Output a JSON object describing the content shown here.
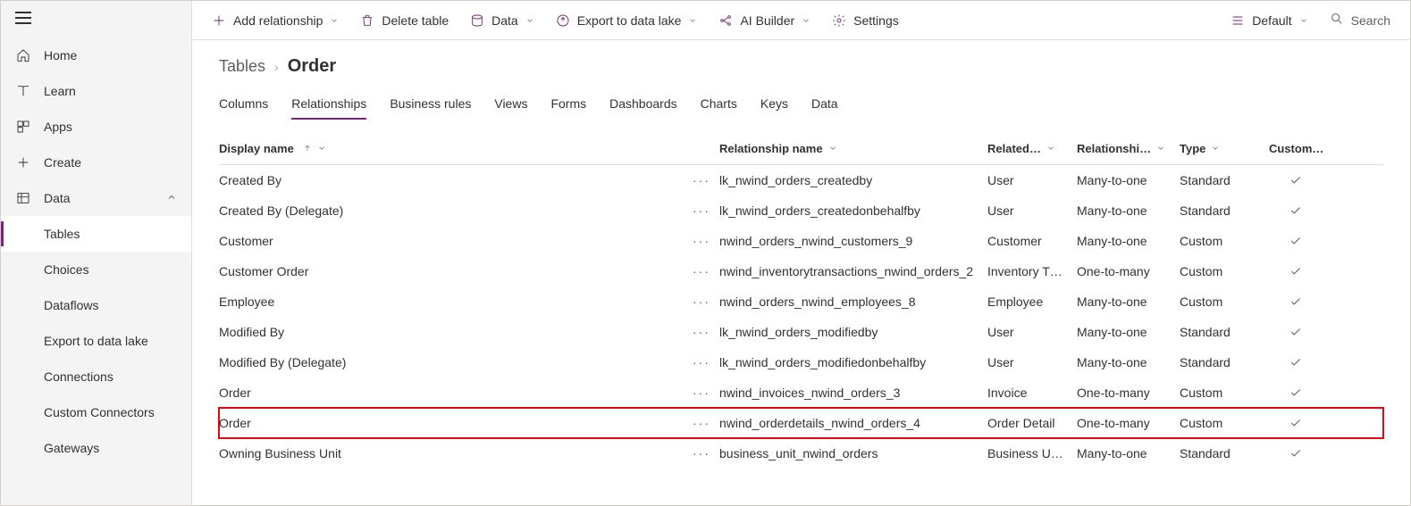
{
  "sidebar": {
    "items": [
      {
        "label": "Home"
      },
      {
        "label": "Learn"
      },
      {
        "label": "Apps"
      },
      {
        "label": "Create"
      },
      {
        "label": "Data"
      }
    ],
    "dataChildren": [
      {
        "label": "Tables"
      },
      {
        "label": "Choices"
      },
      {
        "label": "Dataflows"
      },
      {
        "label": "Export to data lake"
      },
      {
        "label": "Connections"
      },
      {
        "label": "Custom Connectors"
      },
      {
        "label": "Gateways"
      }
    ]
  },
  "commandBar": {
    "addRelationship": "Add relationship",
    "deleteTable": "Delete table",
    "data": "Data",
    "exportDataLake": "Export to data lake",
    "aiBuilder": "AI Builder",
    "settings": "Settings",
    "default": "Default",
    "search": "Search"
  },
  "breadcrumb": {
    "parent": "Tables",
    "current": "Order"
  },
  "tabs": [
    "Columns",
    "Relationships",
    "Business rules",
    "Views",
    "Forms",
    "Dashboards",
    "Charts",
    "Keys",
    "Data"
  ],
  "activeTab": "Relationships",
  "columns": {
    "displayName": "Display name",
    "relName": "Relationship name",
    "related": "Related…",
    "relType": "Relationshi…",
    "type": "Type",
    "custom": "Custom…"
  },
  "rows": [
    {
      "display": "Created By",
      "name": "lk_nwind_orders_createdby",
      "related": "User",
      "reltype": "Many-to-one",
      "type": "Standard"
    },
    {
      "display": "Created By (Delegate)",
      "name": "lk_nwind_orders_createdonbehalfby",
      "related": "User",
      "reltype": "Many-to-one",
      "type": "Standard"
    },
    {
      "display": "Customer",
      "name": "nwind_orders_nwind_customers_9",
      "related": "Customer",
      "reltype": "Many-to-one",
      "type": "Custom"
    },
    {
      "display": "Customer Order",
      "name": "nwind_inventorytransactions_nwind_orders_2",
      "related": "Inventory T…",
      "reltype": "One-to-many",
      "type": "Custom"
    },
    {
      "display": "Employee",
      "name": "nwind_orders_nwind_employees_8",
      "related": "Employee",
      "reltype": "Many-to-one",
      "type": "Custom"
    },
    {
      "display": "Modified By",
      "name": "lk_nwind_orders_modifiedby",
      "related": "User",
      "reltype": "Many-to-one",
      "type": "Standard"
    },
    {
      "display": "Modified By (Delegate)",
      "name": "lk_nwind_orders_modifiedonbehalfby",
      "related": "User",
      "reltype": "Many-to-one",
      "type": "Standard"
    },
    {
      "display": "Order",
      "name": "nwind_invoices_nwind_orders_3",
      "related": "Invoice",
      "reltype": "One-to-many",
      "type": "Custom"
    },
    {
      "display": "Order",
      "name": "nwind_orderdetails_nwind_orders_4",
      "related": "Order Detail",
      "reltype": "One-to-many",
      "type": "Custom",
      "highlight": true
    },
    {
      "display": "Owning Business Unit",
      "name": "business_unit_nwind_orders",
      "related": "Business U…",
      "reltype": "Many-to-one",
      "type": "Standard"
    }
  ]
}
